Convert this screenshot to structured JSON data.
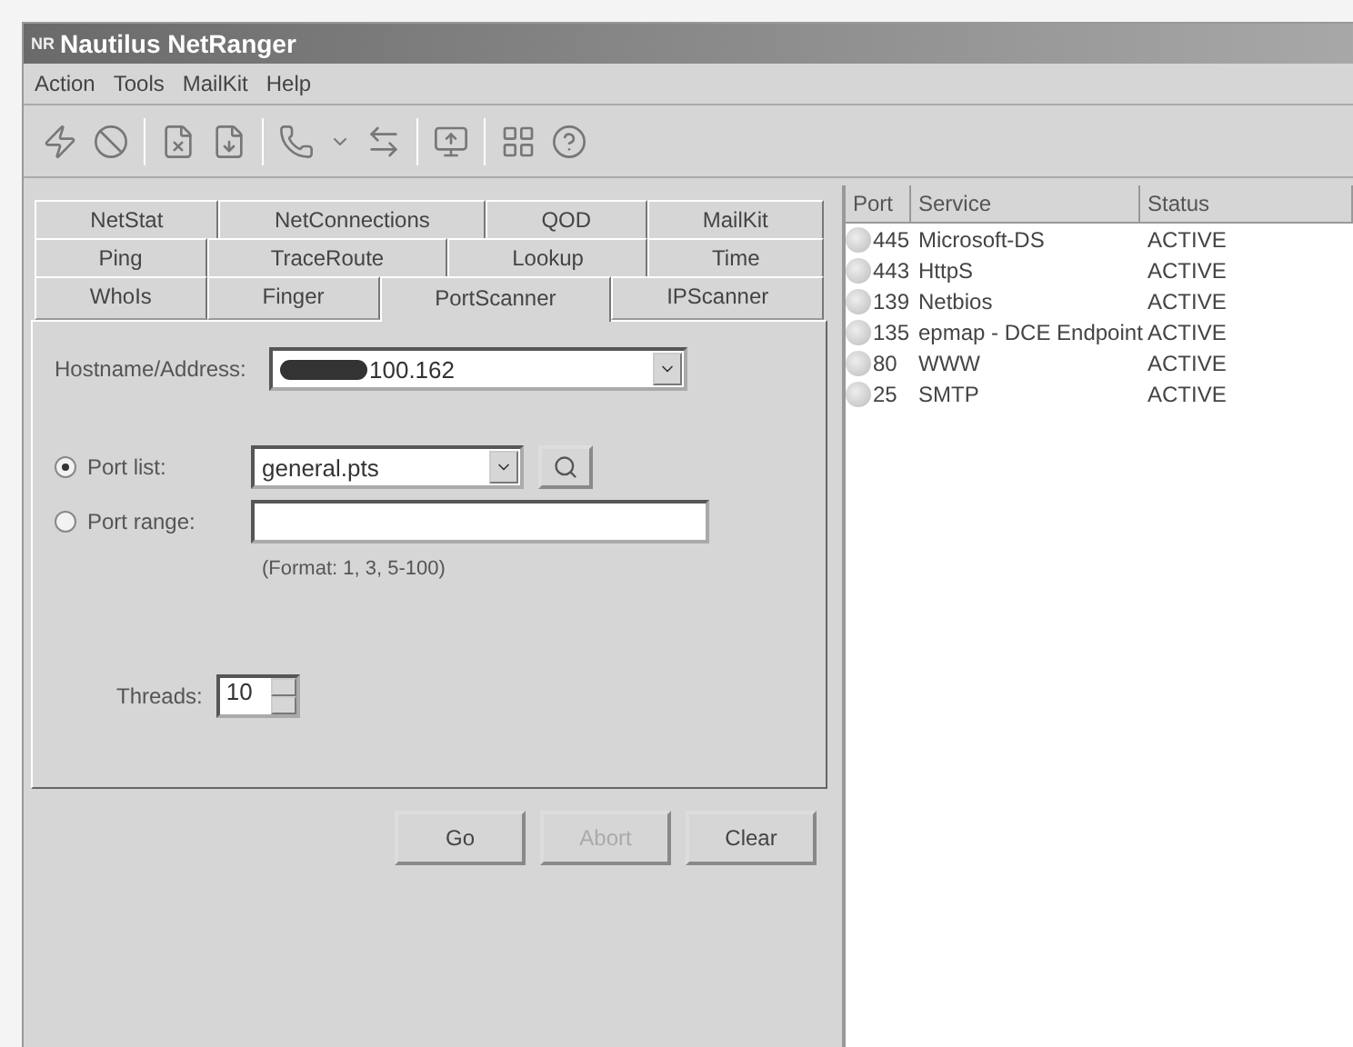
{
  "window": {
    "logo": "NR",
    "title": "Nautilus NetRanger"
  },
  "menu": [
    "Action",
    "Tools",
    "MailKit",
    "Help"
  ],
  "tab_rows": [
    [
      {
        "label": "NetStat",
        "selected": false
      },
      {
        "label": "NetConnections",
        "selected": false
      },
      {
        "label": "QOD",
        "selected": false
      },
      {
        "label": "MailKit",
        "selected": false
      }
    ],
    [
      {
        "label": "Ping",
        "selected": false
      },
      {
        "label": "TraceRoute",
        "selected": false
      },
      {
        "label": "Lookup",
        "selected": false
      },
      {
        "label": "Time",
        "selected": false
      }
    ],
    [
      {
        "label": "WhoIs",
        "selected": false
      },
      {
        "label": "Finger",
        "selected": false
      },
      {
        "label": "PortScanner",
        "selected": true
      },
      {
        "label": "IPScanner",
        "selected": false
      }
    ]
  ],
  "form": {
    "hostname": {
      "label": "Hostname/Address:",
      "value": "100.162"
    },
    "port_list": {
      "label": "Port list:",
      "selected": true,
      "value": "general.pts"
    },
    "port_range": {
      "label": "Port range:",
      "selected": false
    },
    "format_hint": "(Format: 1, 3, 5-100)",
    "threads": {
      "label": "Threads:",
      "value": "10"
    }
  },
  "buttons": [
    {
      "label": "Go",
      "disabled": false
    },
    {
      "label": "Abort",
      "disabled": true
    },
    {
      "label": "Clear",
      "disabled": false
    }
  ],
  "results": {
    "columns": [
      "Port",
      "Service",
      "Status"
    ],
    "rows": [
      {
        "port": "445",
        "service": "Microsoft-DS",
        "status": "ACTIVE"
      },
      {
        "port": "443",
        "service": "HttpS",
        "status": "ACTIVE"
      },
      {
        "port": "139",
        "service": "Netbios",
        "status": "ACTIVE"
      },
      {
        "port": "135",
        "service": "epmap - DCE Endpoint",
        "status": "ACTIVE"
      },
      {
        "port": "80",
        "service": "WWW",
        "status": "ACTIVE"
      },
      {
        "port": "25",
        "service": "SMTP",
        "status": "ACTIVE"
      }
    ]
  }
}
